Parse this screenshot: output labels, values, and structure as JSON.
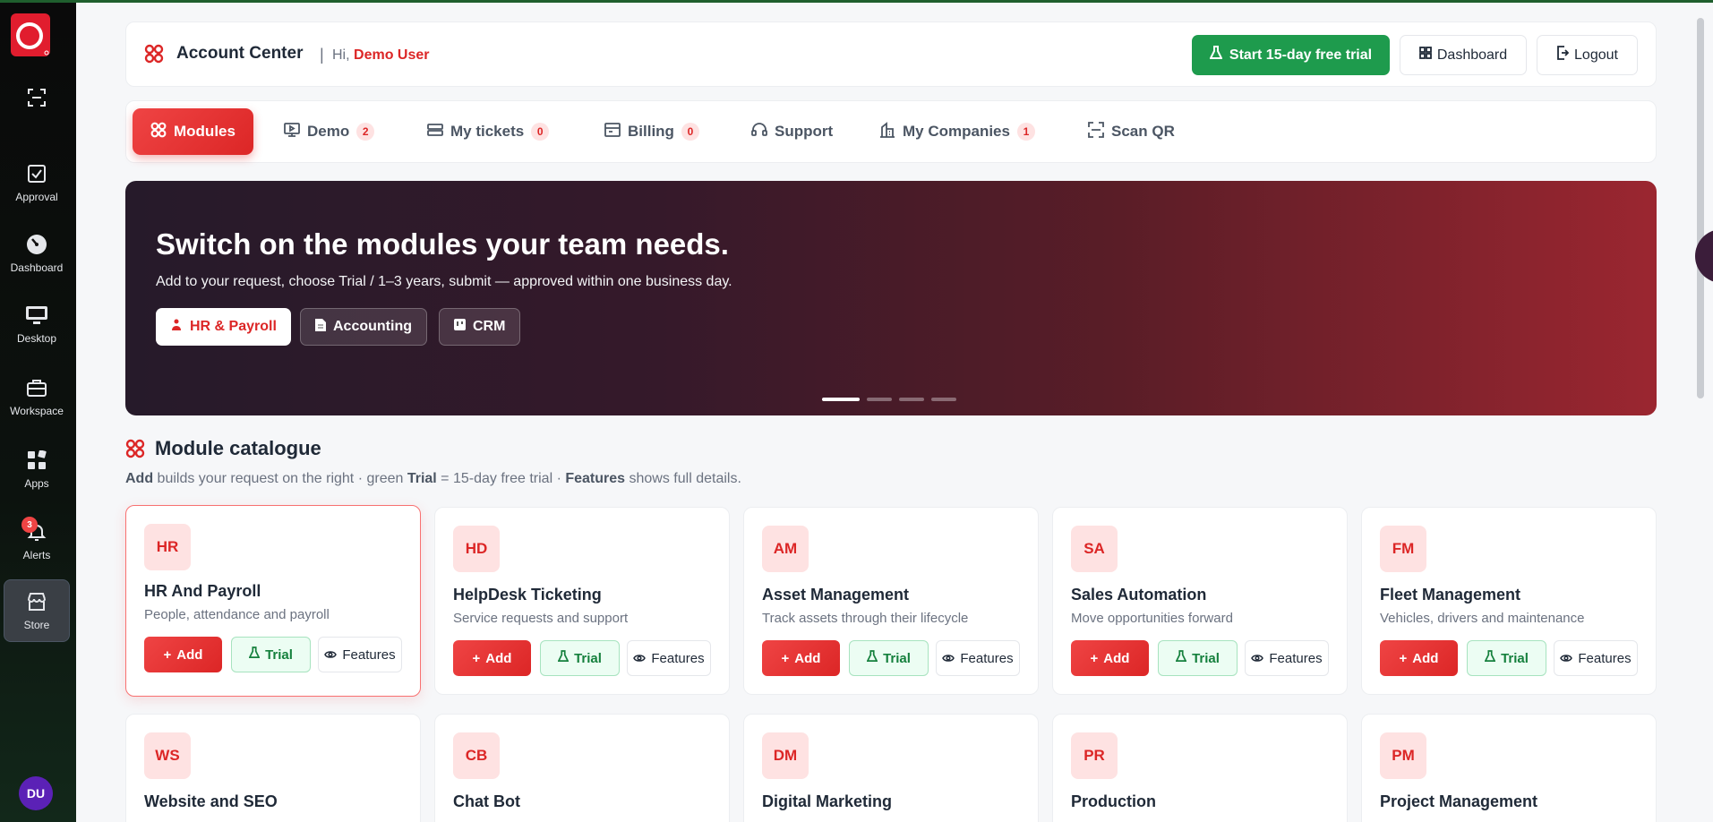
{
  "sidebar": {
    "items": [
      {
        "label": ""
      },
      {
        "label": "Approval"
      },
      {
        "label": "Dashboard"
      },
      {
        "label": "Desktop"
      },
      {
        "label": "Workspace"
      },
      {
        "label": "Apps"
      },
      {
        "label": "Alerts",
        "badge": "3"
      },
      {
        "label": "Store"
      }
    ],
    "avatar": "DU"
  },
  "header": {
    "title": "Account Center",
    "separator": "|",
    "greeting": "Hi,",
    "user": "Demo User",
    "trial_button": "Start 15-day free trial",
    "dashboard_button": "Dashboard",
    "logout_button": "Logout"
  },
  "tabs": [
    {
      "label": "Modules"
    },
    {
      "label": "Demo",
      "count": "2"
    },
    {
      "label": "My tickets",
      "count": "0"
    },
    {
      "label": "Billing",
      "count": "0"
    },
    {
      "label": "Support"
    },
    {
      "label": "My Companies",
      "count": "1"
    },
    {
      "label": "Scan QR"
    }
  ],
  "hero": {
    "title": "Switch on the modules your team needs.",
    "subtitle": "Add to your request, choose Trial / 1–3 years, submit — approved within one business day.",
    "chips": [
      "HR & Payroll",
      "Accounting",
      "CRM"
    ]
  },
  "catalogue": {
    "title": "Module catalogue",
    "sub_add": "Add",
    "sub_text1": " builds your request on the right · green ",
    "sub_trial": "Trial",
    "sub_text2": " = 15-day free trial · ",
    "sub_features": "Features",
    "sub_text3": " shows full details.",
    "add_label": "Add",
    "trial_label": "Trial",
    "features_label": "Features",
    "modules": [
      {
        "abbr": "HR",
        "name": "HR And Payroll",
        "desc": "People, attendance and payroll"
      },
      {
        "abbr": "HD",
        "name": "HelpDesk Ticketing",
        "desc": "Service requests and support"
      },
      {
        "abbr": "AM",
        "name": "Asset Management",
        "desc": "Track assets through their lifecycle"
      },
      {
        "abbr": "SA",
        "name": "Sales Automation",
        "desc": "Move opportunities forward"
      },
      {
        "abbr": "FM",
        "name": "Fleet Management",
        "desc": "Vehicles, drivers and maintenance"
      },
      {
        "abbr": "WS",
        "name": "Website and SEO",
        "desc": ""
      },
      {
        "abbr": "CB",
        "name": "Chat Bot",
        "desc": ""
      },
      {
        "abbr": "DM",
        "name": "Digital Marketing",
        "desc": ""
      },
      {
        "abbr": "PR",
        "name": "Production",
        "desc": ""
      },
      {
        "abbr": "PM",
        "name": "Project Management",
        "desc": ""
      }
    ]
  },
  "colors": {
    "accent": "#dc2626",
    "trial_green": "#1e9b4d",
    "sidebar_bg": "#0a0a0a"
  }
}
